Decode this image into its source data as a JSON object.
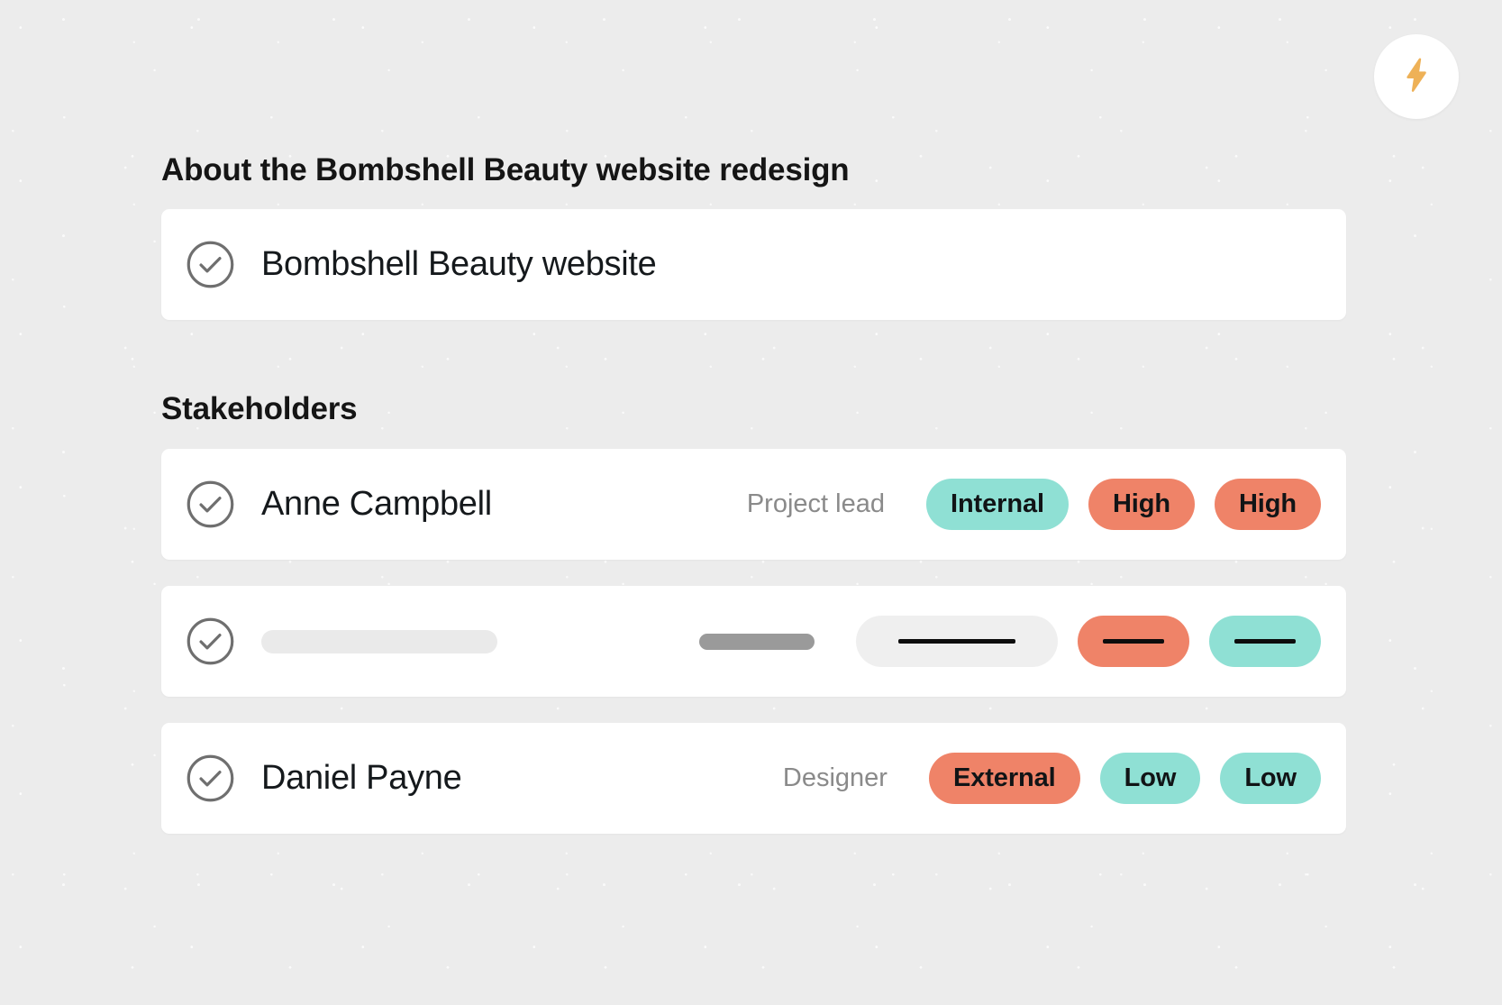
{
  "top_badge": {
    "icon": "lightning-bolt-icon",
    "color": "#eeb157"
  },
  "about": {
    "heading": "About the Bombshell Beauty website redesign",
    "item": {
      "label": "Bombshell Beauty website",
      "status_icon": "check-circle-icon"
    }
  },
  "stakeholders": {
    "heading": "Stakeholders",
    "rows": [
      {
        "status_icon": "check-circle-icon",
        "name": "Anne Campbell",
        "role": "Project lead",
        "pills": [
          {
            "label": "Internal",
            "color": "#8fe0d4"
          },
          {
            "label": "High",
            "color": "#ef8368"
          },
          {
            "label": "High",
            "color": "#ef8368"
          }
        ]
      },
      {
        "status_icon": "check-circle-icon",
        "name": "",
        "role": "",
        "redacted": "true",
        "pills": [
          {
            "label": "",
            "color": "#efefef"
          },
          {
            "label": "",
            "color": "#ef8368"
          },
          {
            "label": "",
            "color": "#8fe0d4"
          }
        ]
      },
      {
        "status_icon": "check-circle-icon",
        "name": "Daniel Payne",
        "role": "Designer",
        "pills": [
          {
            "label": "External",
            "color": "#ef8368"
          },
          {
            "label": "Low",
            "color": "#8fe0d4"
          },
          {
            "label": "Low",
            "color": "#8fe0d4"
          }
        ]
      }
    ]
  },
  "colors": {
    "background": "#ececec",
    "card": "#ffffff",
    "teal": "#8fe0d4",
    "orange": "#ef8368",
    "amber": "#eeb157",
    "text": "#151515",
    "muted": "#8a8a8a"
  }
}
